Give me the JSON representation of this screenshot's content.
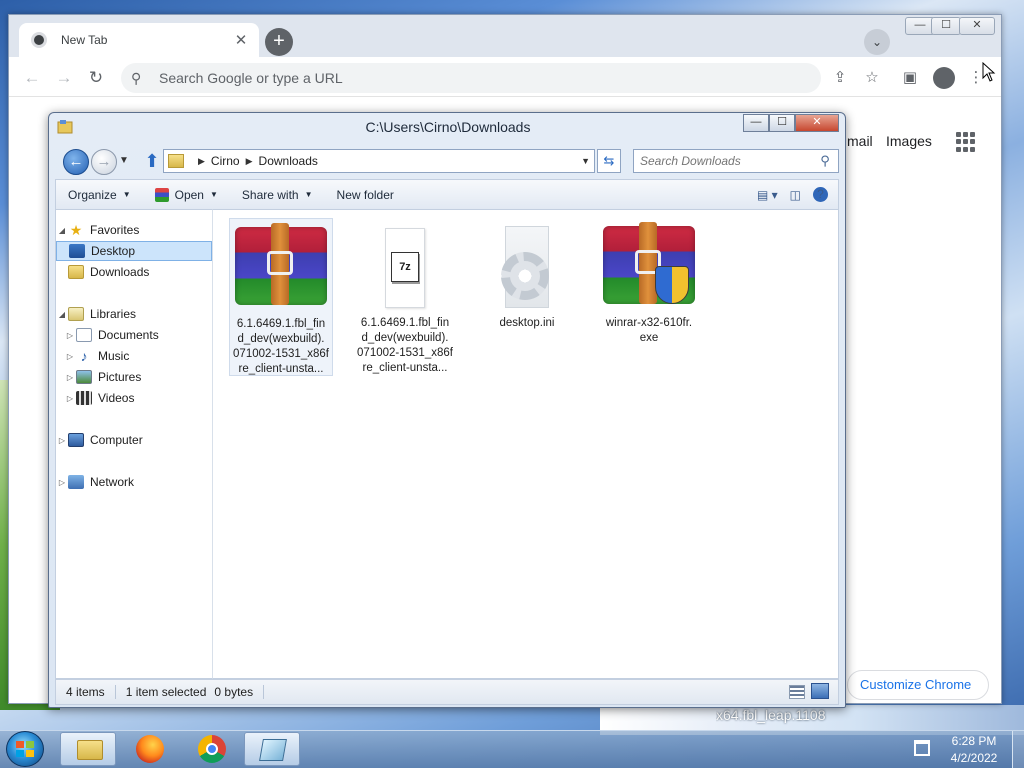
{
  "chrome": {
    "tab_title": "New Tab",
    "tab_close": "✕",
    "new_tab": "+",
    "omnibox_placeholder": "Search Google or type a URL",
    "gmail_label": "mail",
    "images_label": "Images",
    "customize_label": "Customize Chrome",
    "window_buttons": {
      "minimize": "—",
      "maximize": "☐",
      "close": "✕"
    },
    "toolbar_icons": [
      "back-icon",
      "forward-icon",
      "reload-icon",
      "share-icon",
      "bookmark-star-icon",
      "side-panel-icon",
      "profile-icon",
      "more-icon"
    ]
  },
  "explorer": {
    "title": "C:\\Users\\Cirno\\Downloads",
    "window_buttons": {
      "minimize": "—",
      "maximize": "☐",
      "close": "✕"
    },
    "breadcrumb": [
      "Cirno",
      "Downloads"
    ],
    "search_placeholder": "Search Downloads",
    "commands": {
      "organize": "Organize",
      "open": "Open",
      "share_with": "Share with",
      "new_folder": "New folder"
    },
    "nav": {
      "favorites": "Favorites",
      "desktop": "Desktop",
      "downloads": "Downloads",
      "libraries": "Libraries",
      "documents": "Documents",
      "music": "Music",
      "pictures": "Pictures",
      "videos": "Videos",
      "computer": "Computer",
      "network": "Network"
    },
    "files": [
      {
        "name_lines": [
          "6.1.6469.1.fbl_fin",
          "d_dev(wexbuild).",
          "071002-1531_x86f",
          "re_client-unsta..."
        ],
        "icon": "winrar-archive-icon"
      },
      {
        "name_lines": [
          "6.1.6469.1.fbl_fin",
          "d_dev(wexbuild).",
          "071002-1531_x86f",
          "re_client-unsta..."
        ],
        "icon": "7z-archive-icon",
        "badge": "7z"
      },
      {
        "name_lines": [
          "desktop.ini"
        ],
        "icon": "settings-file-icon"
      },
      {
        "name_lines": [
          "winrar-x32-610fr.",
          "exe"
        ],
        "icon": "winrar-installer-icon"
      }
    ],
    "status": {
      "count": "4 items",
      "selected": "1 item selected",
      "size": "0 bytes"
    }
  },
  "taskbar": {
    "items": [
      "windows-explorer",
      "firefox",
      "chrome",
      "shell"
    ],
    "time": "6:28 PM",
    "date": "4/2/2022"
  },
  "desktop_text": "x64.fbl_leap.1108"
}
